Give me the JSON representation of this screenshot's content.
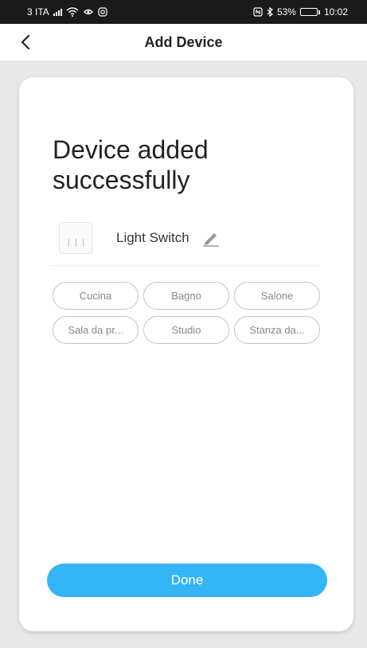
{
  "status_bar": {
    "carrier": "3 ITA",
    "battery": "53%",
    "battery_level": 0.53,
    "time": "10:02",
    "icons": [
      "signal-icon",
      "wifi-icon",
      "location-icon",
      "instagram-icon",
      "nfc-icon",
      "bluetooth-icon",
      "battery-icon"
    ]
  },
  "header": {
    "title": "Add Device",
    "back_icon": "chevron-left-icon"
  },
  "card": {
    "headline": "Device added successfully",
    "device": {
      "name": "Light Switch",
      "thumb_icon": "light-switch-icon",
      "edit_icon": "pencil-icon"
    },
    "rooms": [
      "Cucina",
      "Bagno",
      "Salone",
      "Sala da pr...",
      "Studio",
      "Stanza da..."
    ],
    "done_label": "Done"
  },
  "colors": {
    "accent": "#35b5f5",
    "status_bar": "#1a1a1a",
    "page_bg": "#e8e8e8"
  }
}
